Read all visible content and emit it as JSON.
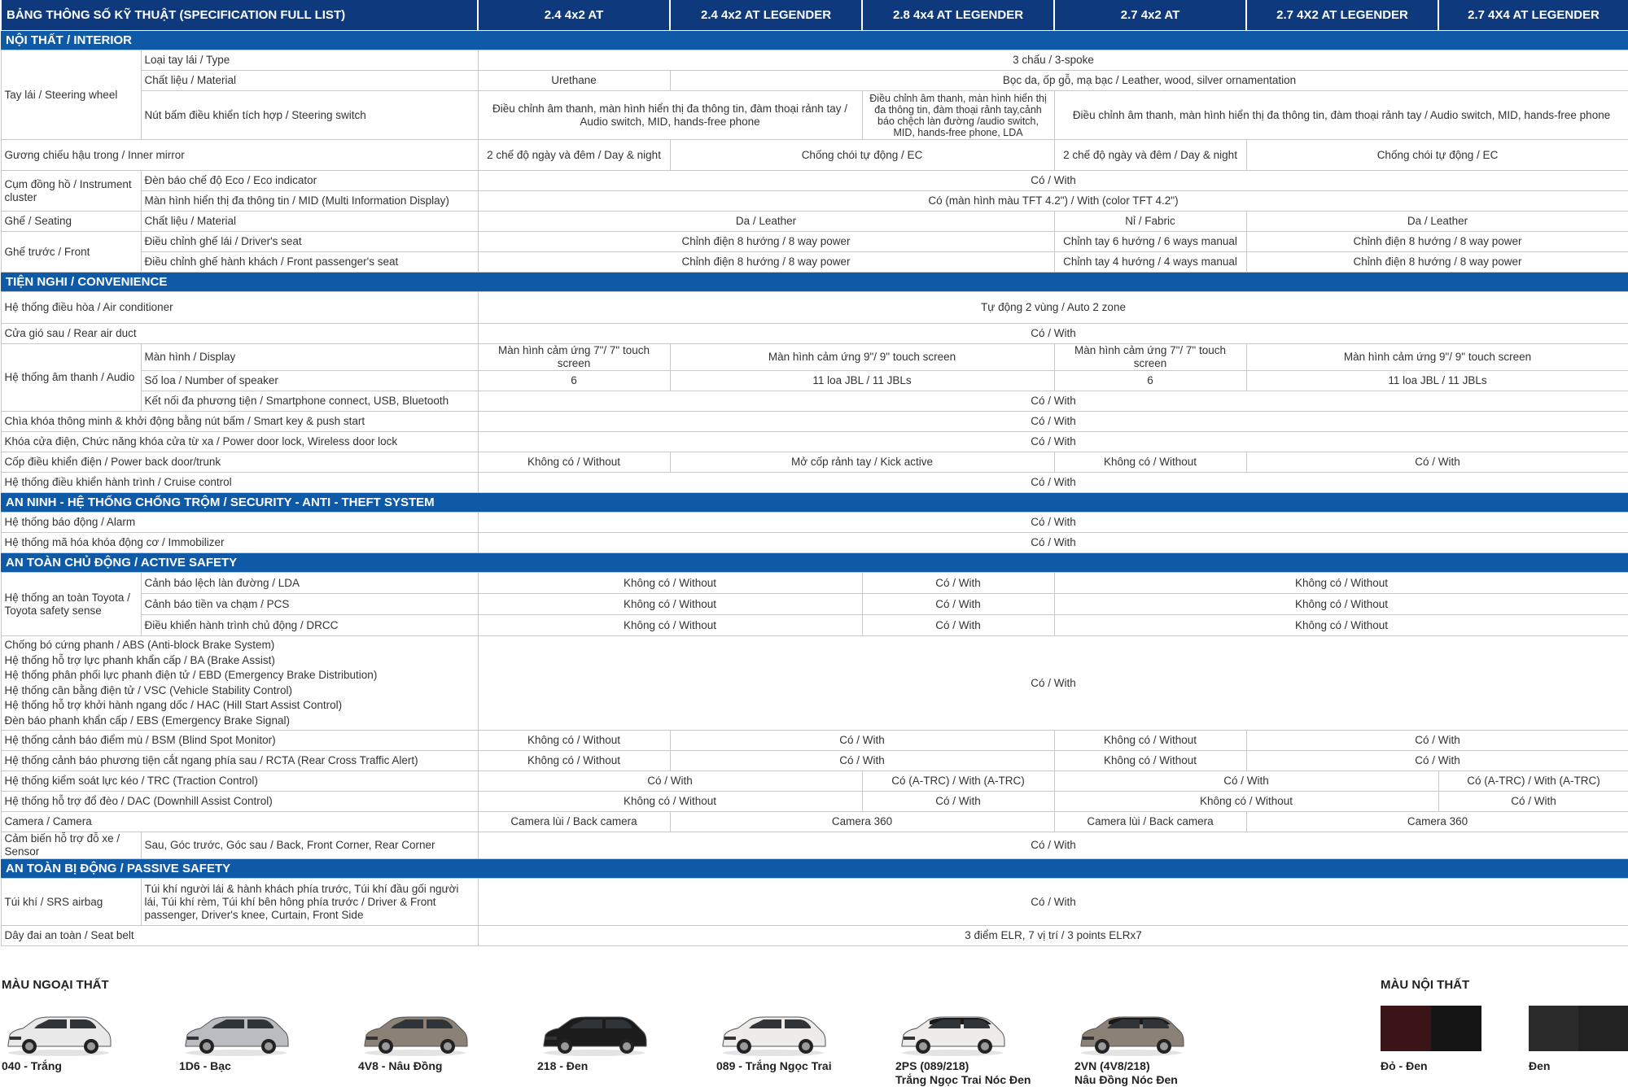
{
  "header": {
    "title": "BẢNG THÔNG SỐ KỸ THUẬT  (SPECIFICATION FULL LIST)",
    "variants": [
      "2.4 4x2 AT",
      "2.4 4x2 AT LEGENDER",
      "2.8 4x4 AT LEGENDER",
      "2.7 4x2 AT",
      "2.7 4X2 AT LEGENDER",
      "2.7 4X4 AT LEGENDER"
    ]
  },
  "sections": {
    "interior": "NỘI THẤT / INTERIOR",
    "convenience": "TIỆN NGHI / CONVENIENCE",
    "security": "AN NINH - HỆ THỐNG CHỐNG TRỘM / SECURITY - ANTI - THEFT SYSTEM",
    "active": "AN TOÀN CHỦ ĐỘNG / ACTIVE SAFETY",
    "passive": "AN TOÀN BỊ ĐỘNG / PASSIVE SAFETY"
  },
  "interior": {
    "steering": "Tay lái / Steering wheel",
    "steering_type": "Loại tay lái / Type",
    "steering_type_val": "3 chấu / 3-spoke",
    "steering_material": "Chất liệu / Material",
    "steering_material_v1": "Urethane",
    "steering_material_v2": "Bọc da, ốp gỗ, mạ bạc / Leather, wood, silver ornamentation",
    "steering_switch": "Nút bấm điều khiển tích hợp / Steering switch",
    "steering_switch_v1": "Điều chỉnh âm thanh, màn hình hiển thị đa thông tin, đàm thoại rảnh tay / Audio switch, MID, hands-free phone",
    "steering_switch_v2": "Điều chỉnh âm thanh, màn hình hiển thị đa thông tin, đàm thoại rảnh tay,cảnh báo chệch làn đường /audio switch, MID, hands-free phone, LDA",
    "steering_switch_v3": "Điều chỉnh âm thanh, màn hình hiển thị đa thông tin, đàm thoại rảnh tay / Audio switch, MID, hands-free phone",
    "mirror": "Gương chiếu hậu trong / Inner mirror",
    "mirror_dn": "2 chế độ ngày và đêm / Day & night",
    "mirror_ec": "Chống chói tự động / EC",
    "cluster": "Cụm đồng hồ / Instrument cluster",
    "eco": "Đèn báo chế độ Eco / Eco indicator",
    "with": "Có / With",
    "mid": "Màn hình hiển thị đa thông tin / MID (Multi Information Display)",
    "mid_val": "Có (màn hình màu TFT 4.2\") / With (color TFT 4.2\")",
    "seating": "Ghế / Seating",
    "seat_material": "Chất liệu / Material",
    "leather": "Da / Leather",
    "fabric": "Nỉ / Fabric",
    "front": "Ghế trước / Front",
    "driver_seat": "Điều chỉnh ghế lái / Driver's seat",
    "power8": "Chỉnh điện 8 hướng / 8 way power",
    "manual6": "Chỉnh tay 6 hướng / 6 ways manual",
    "passenger_seat": "Điều chỉnh ghế hành khách / Front passenger's seat",
    "manual4": "Chỉnh tay 4 hướng / 4 ways manual"
  },
  "convenience": {
    "ac": "Hệ thống điều hòa / Air conditioner",
    "ac_val": "Tự động 2 vùng / Auto 2 zone",
    "rear_duct": "Cửa gió sau / Rear air duct",
    "with": "Có / With",
    "audio": "Hệ thống âm thanh / Audio",
    "display": "Màn hình / Display",
    "screen7": "Màn hình cảm ứng 7\"/ 7\" touch screen",
    "screen9": "Màn hình cảm ứng 9\"/ 9\" touch screen",
    "speakers": "Số loa / Number of speaker",
    "six": "6",
    "jbl": "11 loa JBL / 11 JBLs",
    "media": "Kết nối đa phương tiện / Smartphone connect, USB, Bluetooth",
    "smart_key": "Chìa khóa thông minh & khởi động bằng nút bấm / Smart key & push start",
    "door_lock": "Khóa cửa điện, Chức năng khóa cửa từ xa / Power door lock, Wireless door lock",
    "back_door": "Cốp điều khiển điện / Power back door/trunk",
    "without": "Không có / Without",
    "kick": "Mở cốp rảnh tay / Kick active",
    "cruise": "Hệ thống điều khiển hành trình / Cruise control"
  },
  "security": {
    "alarm": "Hệ thống báo động / Alarm",
    "immobilizer": "Hệ thống mã hóa khóa động cơ / Immobilizer",
    "with": "Có / With"
  },
  "active": {
    "tss": "Hệ thống an toàn Toyota / Toyota safety sense",
    "lda": "Cảnh báo lệch làn đường / LDA",
    "pcs": "Cảnh báo tiền va chạm / PCS",
    "drcc": "Điều khiển hành trình chủ động / DRCC",
    "without": "Không có / Without",
    "with": "Có / With",
    "brakes": [
      "Chống bó cứng phanh / ABS (Anti-block Brake System)",
      "Hệ thống hỗ trợ lực phanh khẩn cấp / BA (Brake Assist)",
      "Hệ thống phân phối lực phanh điện tử / EBD (Emergency Brake Distribution)",
      "Hệ thống cân bằng điện tử / VSC (Vehicle Stability Control)",
      "Hệ thống hỗ trợ khởi hành ngang dốc / HAC (Hill Start Assist Control)",
      "Đèn báo phanh khẩn cấp / EBS (Emergency Brake Signal)"
    ],
    "bsm": "Hệ thống cảnh báo điểm mù / BSM (Blind Spot Monitor)",
    "rcta": "Hệ thống cảnh báo phương tiện cắt ngang phía sau / RCTA (Rear Cross Traffic Alert)",
    "trc": "Hệ thống kiểm soát lực kéo / TRC (Traction Control)",
    "atrc": "Có (A-TRC) / With (A-TRC)",
    "dac": "Hệ thống hỗ trợ đổ đèo / DAC (Downhill Assist Control)",
    "camera": "Camera / Camera",
    "back_camera": "Camera lùi / Back camera",
    "camera360": "Camera 360",
    "sensor": "Cảm biến hỗ trợ đỗ xe / Sensor",
    "sensor_pos": "Sau, Góc trước, Góc sau / Back, Front Corner, Rear Corner"
  },
  "passive": {
    "airbag": "Túi khí / SRS airbag",
    "airbag_desc": "Túi khí người lái & hành khách phía trước, Túi khí đầu gối người lái, Túi khí rèm, Túi khí bên hông phía trước / Driver & Front passenger, Driver's knee, Curtain, Front Side",
    "with": "Có / With",
    "seat_belt": "Dây đai an toàn / Seat belt",
    "seat_belt_val": "3 điểm ELR, 7 vị trí / 3 points ELRx7"
  },
  "exterior_colors": {
    "title": "MÀU NGOẠI THẤT",
    "items": [
      {
        "label": "040 - Trắng",
        "label2": "",
        "color": "#e9e9e9"
      },
      {
        "label": "1D6 - Bạc",
        "label2": "",
        "color": "#b9bcc0"
      },
      {
        "label": "4V8 - Nâu Đồng",
        "label2": "",
        "color": "#8c8176"
      },
      {
        "label": "218 - Đen",
        "label2": "",
        "color": "#1c1c1c"
      },
      {
        "label": "089 - Trắng Ngọc Trai",
        "label2": "",
        "color": "#eeece8"
      },
      {
        "label": "2PS (089/218)",
        "label2": "Trắng Ngọc Trai Nóc Đen",
        "color": "#eeece8"
      },
      {
        "label": "2VN (4V8/218)",
        "label2": "Nâu Đồng Nóc Đen",
        "color": "#8c8176"
      }
    ]
  },
  "interior_colors": {
    "title": "MÀU NỘI THẤT",
    "items": [
      {
        "label": "Đỏ - Đen",
        "color1": "#3a1416",
        "color2": "#151515"
      },
      {
        "label": "Đen",
        "color1": "#2b2b2b",
        "color2": "#222222"
      }
    ]
  }
}
